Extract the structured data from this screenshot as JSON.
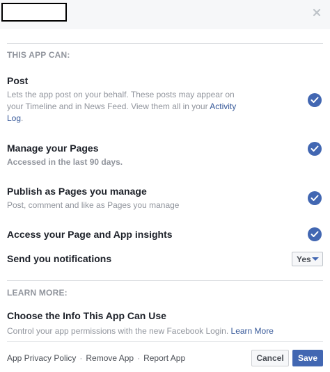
{
  "dialog": {
    "close_glyph": "×",
    "close_icon": "close-icon"
  },
  "can_section": {
    "label": "THIS APP CAN:",
    "permissions": [
      {
        "title": "Post",
        "desc_part1": "Lets the app post on your behalf. These posts may appear on your Timeline and in News Feed. View them all in your ",
        "desc_link": "Activity Log",
        "desc_part2": ".",
        "checked": true
      },
      {
        "title": "Manage your Pages",
        "desc": "Accessed in the last 90 days.",
        "checked": true
      },
      {
        "title": "Publish as Pages you manage",
        "desc": "Post, comment and like as Pages you manage",
        "checked": true
      },
      {
        "title": "Access your Page and App insights",
        "checked": true
      }
    ],
    "notifications": {
      "title": "Send you notifications",
      "selected": "Yes"
    }
  },
  "learn_section": {
    "label": "LEARN MORE:",
    "title": "Choose the Info This App Can Use",
    "desc": "Control your app permissions with the new Facebook Login. ",
    "link": "Learn More"
  },
  "footer": {
    "links": [
      "App Privacy Policy",
      "Remove App",
      "Report App"
    ],
    "separator": "·",
    "cancel_label": "Cancel",
    "save_label": "Save"
  },
  "colors": {
    "accent": "#4267b2",
    "link": "#365899",
    "muted": "#90949c"
  },
  "icons": {
    "check": "checkmark-icon",
    "dropdown": "caret-down-icon"
  }
}
